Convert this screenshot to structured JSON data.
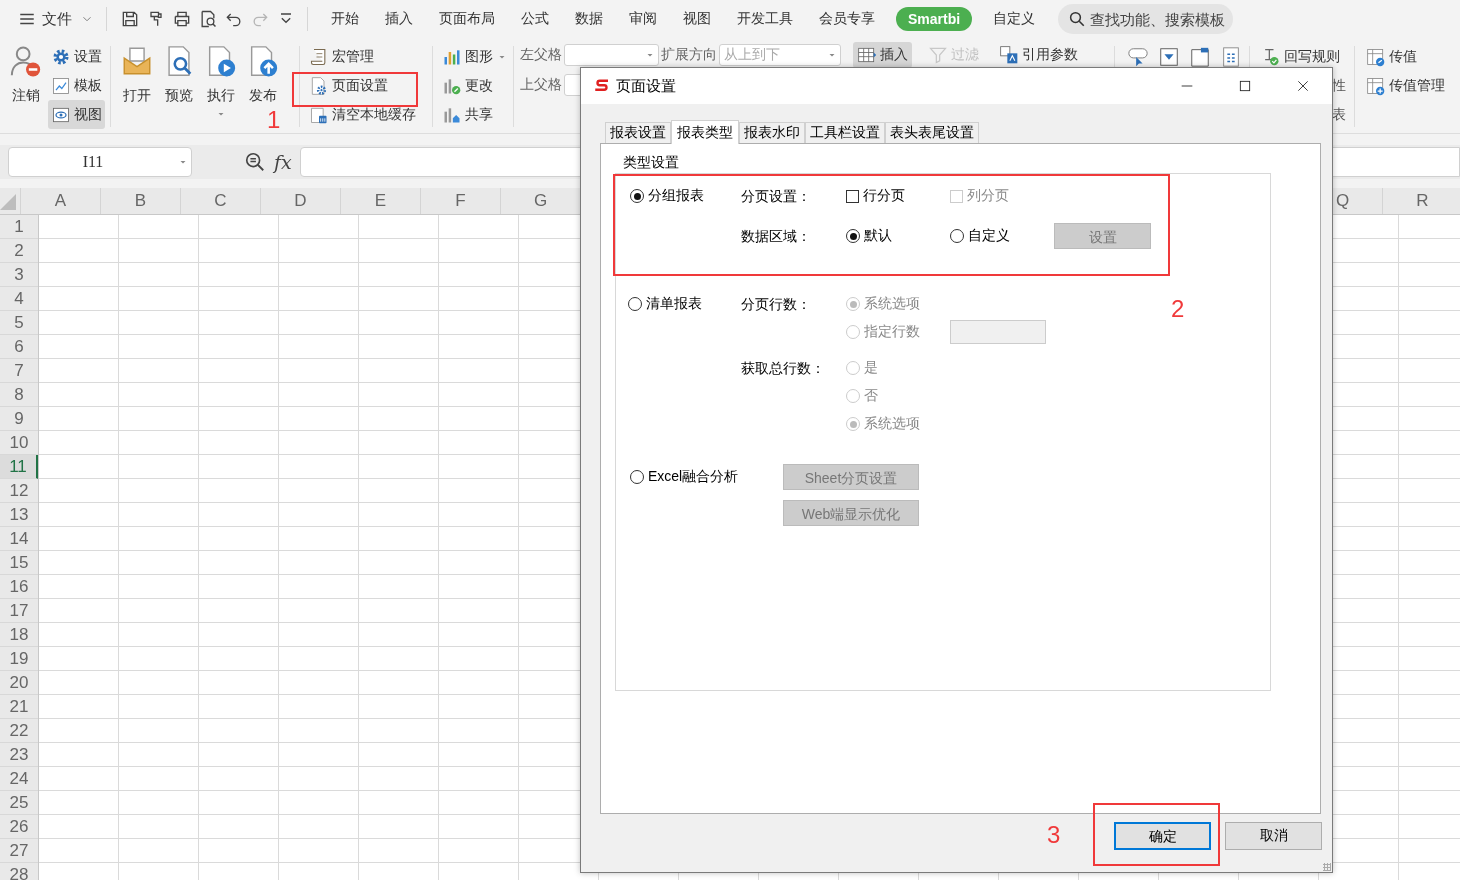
{
  "menu_bar": {
    "file_menu": "文件",
    "quick_access": [
      {
        "kind": "save",
        "disabled": false
      },
      {
        "kind": "painter",
        "disabled": false
      },
      {
        "kind": "print",
        "disabled": false
      },
      {
        "kind": "preview",
        "disabled": false
      },
      {
        "kind": "undo",
        "disabled": false
      },
      {
        "kind": "redo",
        "disabled": true
      },
      {
        "kind": "more",
        "disabled": false
      }
    ],
    "tabs": [
      {
        "label": "开始",
        "selected": false
      },
      {
        "label": "插入",
        "selected": false
      },
      {
        "label": "页面布局",
        "selected": false
      },
      {
        "label": "公式",
        "selected": false
      },
      {
        "label": "数据",
        "selected": false
      },
      {
        "label": "审阅",
        "selected": false
      },
      {
        "label": "视图",
        "selected": false
      },
      {
        "label": "开发工具",
        "selected": false
      },
      {
        "label": "会员专享",
        "selected": false
      },
      {
        "label": "Smartbi",
        "selected": true
      },
      {
        "label": "自定义",
        "selected": false
      }
    ],
    "search": {
      "placeholder": "查找功能、搜索模板"
    }
  },
  "ribbon": {
    "account": {
      "big": {
        "label": "注销",
        "kind": "logout"
      },
      "small": [
        {
          "label": "设置",
          "kind": "gear",
          "selected": false
        },
        {
          "label": "模板",
          "kind": "template",
          "selected": false
        },
        {
          "label": "视图",
          "kind": "eye",
          "selected": true
        }
      ]
    },
    "big_buttons": [
      {
        "label": "打开",
        "kind": "open",
        "dropdown": false
      },
      {
        "label": "预览",
        "kind": "docsearch",
        "dropdown": false
      },
      {
        "label": "执行",
        "kind": "run",
        "dropdown": true
      },
      {
        "label": "发布",
        "kind": "publish",
        "dropdown": false
      }
    ],
    "manage": [
      {
        "label": "宏管理",
        "kind": "scroll"
      },
      {
        "label": "页面设置",
        "kind": "docgear"
      },
      {
        "label": "清空本地缓存",
        "kind": "trash"
      }
    ],
    "chart": [
      {
        "label": "图形",
        "kind": "chart",
        "dropdown": true
      },
      {
        "label": "更改",
        "kind": "chartedit",
        "dropdown": false
      },
      {
        "label": "共享",
        "kind": "chartshare",
        "dropdown": false
      }
    ],
    "parent_cells": {
      "left_label": "左父格",
      "top_label": "上父格",
      "direction_label": "扩展方向",
      "direction_value": "从上到下"
    },
    "tools": [
      {
        "label": "插入",
        "kind": "table",
        "disabled": false,
        "pressed": true
      },
      {
        "label": "过滤",
        "kind": "funnel",
        "disabled": true,
        "pressed": false
      },
      {
        "label": "引用参数",
        "kind": "param",
        "disabled": false,
        "pressed": false
      }
    ],
    "controls": [
      {
        "kind": "btn"
      },
      {
        "kind": "combo"
      },
      {
        "kind": "tabpage"
      },
      {
        "kind": "grid"
      }
    ],
    "writeback": {
      "label": "回写规则",
      "kind": "writeback",
      "cut_texts": [
        "性",
        "表"
      ]
    },
    "transfer": [
      {
        "label": "传值",
        "kind": "transfer"
      },
      {
        "label": "传值管理",
        "kind": "transferadd"
      }
    ]
  },
  "formula_bar": {
    "name_box": "I11",
    "fx": "fx"
  },
  "sheet": {
    "columns": [
      "A",
      "B",
      "C",
      "D",
      "E",
      "F",
      "G",
      "Q",
      "R"
    ],
    "rows": [
      {
        "label": "1",
        "selected": false
      },
      {
        "label": "2",
        "selected": false
      },
      {
        "label": "3",
        "selected": false
      },
      {
        "label": "4",
        "selected": false
      },
      {
        "label": "5",
        "selected": false
      },
      {
        "label": "6",
        "selected": false
      },
      {
        "label": "7",
        "selected": false
      },
      {
        "label": "8",
        "selected": false
      },
      {
        "label": "9",
        "selected": false
      },
      {
        "label": "10",
        "selected": false
      },
      {
        "label": "11",
        "selected": true
      },
      {
        "label": "12",
        "selected": false
      },
      {
        "label": "13",
        "selected": false
      },
      {
        "label": "14",
        "selected": false
      },
      {
        "label": "15",
        "selected": false
      },
      {
        "label": "16",
        "selected": false
      },
      {
        "label": "17",
        "selected": false
      },
      {
        "label": "18",
        "selected": false
      },
      {
        "label": "19",
        "selected": false
      },
      {
        "label": "20",
        "selected": false
      },
      {
        "label": "21",
        "selected": false
      },
      {
        "label": "22",
        "selected": false
      },
      {
        "label": "23",
        "selected": false
      },
      {
        "label": "24",
        "selected": false
      },
      {
        "label": "25",
        "selected": false
      },
      {
        "label": "26",
        "selected": false
      },
      {
        "label": "27",
        "selected": false
      },
      {
        "label": "28",
        "selected": false
      }
    ]
  },
  "dialog": {
    "title": "页面设置",
    "tabs": [
      {
        "label": "报表设置",
        "selected": false
      },
      {
        "label": "报表类型",
        "selected": true
      },
      {
        "label": "报表水印",
        "selected": false
      },
      {
        "label": "工具栏设置",
        "selected": false
      },
      {
        "label": "表头表尾设置",
        "selected": false
      }
    ],
    "group_title": "类型设置",
    "report_types": [
      {
        "kind": "group",
        "label": "分组报表",
        "selected": true,
        "settings": [
          {
            "kind": "row",
            "label": "分页设置：",
            "options": [
              {
                "kind": "checkbox",
                "label": "行分页",
                "checked": false,
                "disabled": false
              },
              {
                "kind": "checkbox",
                "label": "列分页",
                "checked": false,
                "disabled": true
              }
            ]
          },
          {
            "kind": "row",
            "label": "数据区域：",
            "options": [
              {
                "kind": "radio",
                "label": "默认",
                "checked": true,
                "disabled": false
              },
              {
                "kind": "radio",
                "label": "自定义",
                "checked": false,
                "disabled": false
              },
              {
                "kind": "button",
                "label": "设置",
                "disabled": true
              }
            ]
          }
        ]
      },
      {
        "kind": "list",
        "label": "清单报表",
        "selected": false,
        "settings": [
          {
            "kind": "stack",
            "label": "分页行数：",
            "options": [
              {
                "kind": "radio",
                "label": "系统选项",
                "checked": true,
                "disabled": true
              },
              {
                "kind": "radio_field",
                "label": "指定行数",
                "checked": false,
                "disabled": true
              }
            ]
          },
          {
            "kind": "stack",
            "label": "获取总行数：",
            "options": [
              {
                "kind": "radio",
                "label": "是",
                "checked": false,
                "disabled": true
              },
              {
                "kind": "radio",
                "label": "否",
                "checked": false,
                "disabled": true
              },
              {
                "kind": "radio",
                "label": "系统选项",
                "checked": true,
                "disabled": true
              }
            ]
          }
        ]
      },
      {
        "kind": "excel",
        "label": "Excel融合分析",
        "selected": false,
        "buttons": [
          {
            "label": "Sheet分页设置",
            "disabled": true
          },
          {
            "label": "Web端显示优化",
            "disabled": true
          }
        ]
      }
    ],
    "buttons": [
      {
        "label": "确定",
        "default": true
      },
      {
        "label": "取消",
        "default": false
      }
    ]
  },
  "annotations": [
    {
      "label": "1"
    },
    {
      "label": "2"
    },
    {
      "label": "3"
    }
  ]
}
